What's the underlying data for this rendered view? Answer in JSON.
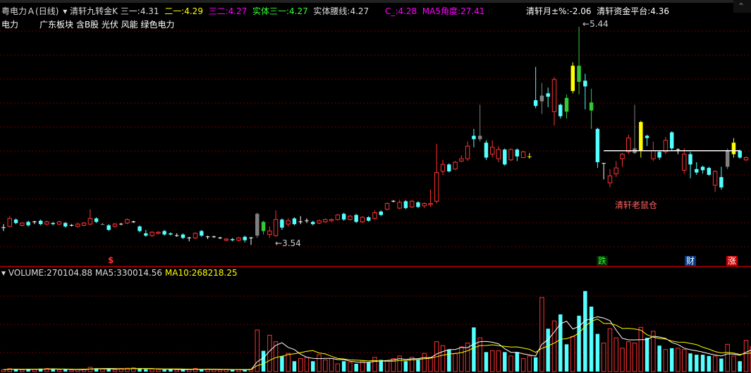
{
  "header": {
    "stock_name": "粤电力Ａ",
    "period": "(日线)",
    "indicator_name": "清轩九转金K",
    "san_yi_label": "三一:",
    "san_yi_value": "4.31",
    "er_yi_label": "二一:",
    "er_yi_value": "4.29",
    "san_er_label": "三二:",
    "san_er_value": "4.27",
    "shiti_label": "实体三一:",
    "shiti_value": "4.27",
    "yaoxian_label": "实体腰线:",
    "yaoxian_value": "4.27",
    "c_label": "C_:",
    "c_value": "4.28",
    "ma5_angle_label": "MA5角度:",
    "ma5_angle_value": "27.41",
    "month_label": "清轩月±%:",
    "month_value": "-2.06",
    "fund_label": "清轩资金平台:",
    "fund_value": "4.36"
  },
  "sector": {
    "industry": "电力",
    "tags": "广东板块 含B股 光伏 风能 绿色电力"
  },
  "annotations": {
    "high_value": "5.44",
    "low_value": "3.54",
    "trap_text": "清轩老鼠仓",
    "marker_dollar": "$",
    "marker_die": "跌",
    "marker_cai": "财",
    "marker_zhang": "涨"
  },
  "volume_header": {
    "volume_label": "VOLUME:",
    "volume_value": "270104.88",
    "ma5_label": "MA5:",
    "ma5_value": "330014.56",
    "ma10_label": "MA10:",
    "ma10_value": "268218.25"
  },
  "colors": {
    "up": "#ff3232",
    "down": "#54ffff",
    "yellow": "#ffff00",
    "gray": "#808080",
    "green": "#34c934",
    "magenta": "#ff00ff"
  },
  "chart_data": {
    "type": "candlestick",
    "price_ylim": [
      3.4,
      5.55
    ],
    "platform_level": 4.36,
    "candles": [
      {
        "o": 3.69,
        "c": 3.69,
        "h": 3.72,
        "l": 3.66,
        "k": "dash"
      },
      {
        "o": 3.7,
        "c": 3.77,
        "h": 3.79,
        "l": 3.69,
        "k": "up"
      },
      {
        "o": 3.76,
        "c": 3.73,
        "h": 3.77,
        "l": 3.72,
        "k": "dn"
      },
      {
        "o": 3.71,
        "c": 3.73,
        "h": 3.74,
        "l": 3.7,
        "k": "up"
      },
      {
        "o": 3.74,
        "c": 3.71,
        "h": 3.75,
        "l": 3.7,
        "k": "dn"
      },
      {
        "o": 3.74,
        "c": 3.74,
        "h": 3.75,
        "l": 3.72,
        "k": "dash"
      },
      {
        "o": 3.75,
        "c": 3.72,
        "h": 3.76,
        "l": 3.71,
        "k": "dn"
      },
      {
        "o": 3.72,
        "c": 3.74,
        "h": 3.75,
        "l": 3.71,
        "k": "up"
      },
      {
        "o": 3.73,
        "c": 3.72,
        "h": 3.74,
        "l": 3.71,
        "k": "dn"
      },
      {
        "o": 3.72,
        "c": 3.74,
        "h": 3.75,
        "l": 3.71,
        "k": "up"
      },
      {
        "o": 3.73,
        "c": 3.7,
        "h": 3.74,
        "l": 3.69,
        "k": "dn"
      },
      {
        "o": 3.71,
        "c": 3.71,
        "h": 3.72,
        "l": 3.7,
        "k": "dash"
      },
      {
        "o": 3.7,
        "c": 3.72,
        "h": 3.73,
        "l": 3.69,
        "k": "up"
      },
      {
        "o": 3.71,
        "c": 3.73,
        "h": 3.74,
        "l": 3.7,
        "k": "up"
      },
      {
        "o": 3.72,
        "c": 3.77,
        "h": 3.85,
        "l": 3.71,
        "k": "up"
      },
      {
        "o": 3.77,
        "c": 3.74,
        "h": 3.78,
        "l": 3.73,
        "k": "dn"
      },
      {
        "o": 3.72,
        "c": 3.72,
        "h": 3.73,
        "l": 3.71,
        "k": "gray"
      },
      {
        "o": 3.71,
        "c": 3.67,
        "h": 3.72,
        "l": 3.66,
        "k": "dn"
      },
      {
        "o": 3.7,
        "c": 3.72,
        "h": 3.73,
        "l": 3.69,
        "k": "up"
      },
      {
        "o": 3.72,
        "c": 3.72,
        "h": 3.73,
        "l": 3.71,
        "k": "dash"
      },
      {
        "o": 3.73,
        "c": 3.76,
        "h": 3.77,
        "l": 3.72,
        "k": "up"
      },
      {
        "o": 3.74,
        "c": 3.74,
        "h": 3.75,
        "l": 3.73,
        "k": "dash"
      },
      {
        "o": 3.7,
        "c": 3.66,
        "h": 3.71,
        "l": 3.65,
        "k": "dn"
      },
      {
        "o": 3.64,
        "c": 3.62,
        "h": 3.67,
        "l": 3.61,
        "k": "dn"
      },
      {
        "o": 3.62,
        "c": 3.65,
        "h": 3.66,
        "l": 3.61,
        "k": "up"
      },
      {
        "o": 3.64,
        "c": 3.65,
        "h": 3.66,
        "l": 3.63,
        "k": "up"
      },
      {
        "o": 3.66,
        "c": 3.63,
        "h": 3.67,
        "l": 3.62,
        "k": "dn"
      },
      {
        "o": 3.64,
        "c": 3.63,
        "h": 3.65,
        "l": 3.62,
        "k": "dn"
      },
      {
        "o": 3.62,
        "c": 3.62,
        "h": 3.64,
        "l": 3.61,
        "k": "dash"
      },
      {
        "o": 3.63,
        "c": 3.6,
        "h": 3.64,
        "l": 3.59,
        "k": "dn"
      },
      {
        "o": 3.6,
        "c": 3.6,
        "h": 3.61,
        "l": 3.57,
        "k": "dash"
      },
      {
        "o": 3.6,
        "c": 3.64,
        "h": 3.65,
        "l": 3.59,
        "k": "up"
      },
      {
        "o": 3.66,
        "c": 3.62,
        "h": 3.67,
        "l": 3.61,
        "k": "dn"
      },
      {
        "o": 3.61,
        "c": 3.61,
        "h": 3.62,
        "l": 3.59,
        "k": "dash"
      },
      {
        "o": 3.61,
        "c": 3.61,
        "h": 3.62,
        "l": 3.6,
        "k": "dash"
      },
      {
        "o": 3.6,
        "c": 3.6,
        "h": 3.61,
        "l": 3.59,
        "k": "dash"
      },
      {
        "o": 3.58,
        "c": 3.59,
        "h": 3.6,
        "l": 3.57,
        "k": "up"
      },
      {
        "o": 3.59,
        "c": 3.58,
        "h": 3.6,
        "l": 3.57,
        "k": "dn"
      },
      {
        "o": 3.58,
        "c": 3.6,
        "h": 3.61,
        "l": 3.57,
        "k": "up"
      },
      {
        "o": 3.61,
        "c": 3.58,
        "h": 3.62,
        "l": 3.56,
        "k": "dn"
      },
      {
        "o": 3.6,
        "c": 3.6,
        "h": 3.61,
        "l": 3.54,
        "k": "dash"
      },
      {
        "o": 3.62,
        "c": 3.81,
        "h": 3.82,
        "l": 3.6,
        "k": "gray"
      },
      {
        "o": 3.74,
        "c": 3.66,
        "h": 3.75,
        "l": 3.63,
        "k": "green"
      },
      {
        "o": 3.63,
        "c": 3.66,
        "h": 3.7,
        "l": 3.6,
        "k": "up"
      },
      {
        "o": 3.62,
        "c": 3.76,
        "h": 3.84,
        "l": 3.61,
        "k": "up"
      },
      {
        "o": 3.76,
        "c": 3.69,
        "h": 3.77,
        "l": 3.67,
        "k": "dn"
      },
      {
        "o": 3.72,
        "c": 3.75,
        "h": 3.77,
        "l": 3.7,
        "k": "up"
      },
      {
        "o": 3.77,
        "c": 3.72,
        "h": 3.78,
        "l": 3.71,
        "k": "dn"
      },
      {
        "o": 3.74,
        "c": 3.74,
        "h": 3.79,
        "l": 3.72,
        "k": "dash"
      },
      {
        "o": 3.75,
        "c": 3.75,
        "h": 3.77,
        "l": 3.73,
        "k": "dash"
      },
      {
        "o": 3.74,
        "c": 3.72,
        "h": 3.75,
        "l": 3.71,
        "k": "dn"
      },
      {
        "o": 3.73,
        "c": 3.75,
        "h": 3.76,
        "l": 3.72,
        "k": "up"
      },
      {
        "o": 3.74,
        "c": 3.76,
        "h": 3.77,
        "l": 3.73,
        "k": "up"
      },
      {
        "o": 3.75,
        "c": 3.76,
        "h": 3.77,
        "l": 3.74,
        "k": "up"
      },
      {
        "o": 3.76,
        "c": 3.8,
        "h": 3.81,
        "l": 3.75,
        "k": "up"
      },
      {
        "o": 3.81,
        "c": 3.76,
        "h": 3.82,
        "l": 3.75,
        "k": "dn"
      },
      {
        "o": 3.76,
        "c": 3.79,
        "h": 3.8,
        "l": 3.75,
        "k": "up"
      },
      {
        "o": 3.8,
        "c": 3.74,
        "h": 3.81,
        "l": 3.73,
        "k": "dn"
      },
      {
        "o": 3.74,
        "c": 3.78,
        "h": 3.79,
        "l": 3.73,
        "k": "up"
      },
      {
        "o": 3.78,
        "c": 3.75,
        "h": 3.79,
        "l": 3.74,
        "k": "dn"
      },
      {
        "o": 3.77,
        "c": 3.82,
        "h": 3.84,
        "l": 3.76,
        "k": "up"
      },
      {
        "o": 3.83,
        "c": 3.8,
        "h": 3.84,
        "l": 3.79,
        "k": "dn"
      },
      {
        "o": 3.85,
        "c": 3.9,
        "h": 3.91,
        "l": 3.84,
        "k": "up"
      },
      {
        "o": 3.92,
        "c": 3.92,
        "h": 3.93,
        "l": 3.91,
        "k": "dash"
      },
      {
        "o": 3.86,
        "c": 3.91,
        "h": 3.93,
        "l": 3.85,
        "k": "up"
      },
      {
        "o": 3.92,
        "c": 3.86,
        "h": 3.93,
        "l": 3.85,
        "k": "dn"
      },
      {
        "o": 3.87,
        "c": 3.92,
        "h": 3.93,
        "l": 3.86,
        "k": "up"
      },
      {
        "o": 3.91,
        "c": 3.87,
        "h": 3.92,
        "l": 3.86,
        "k": "dn"
      },
      {
        "o": 3.88,
        "c": 3.9,
        "h": 3.91,
        "l": 3.86,
        "k": "up"
      },
      {
        "o": 3.89,
        "c": 3.9,
        "h": 4.02,
        "l": 3.87,
        "k": "up"
      },
      {
        "o": 3.92,
        "c": 4.17,
        "h": 4.42,
        "l": 3.9,
        "k": "up"
      },
      {
        "o": 4.18,
        "c": 4.24,
        "h": 4.28,
        "l": 4.15,
        "k": "up"
      },
      {
        "o": 4.24,
        "c": 4.18,
        "h": 4.25,
        "l": 4.17,
        "k": "dn"
      },
      {
        "o": 4.2,
        "c": 4.26,
        "h": 4.27,
        "l": 4.19,
        "k": "up"
      },
      {
        "o": 4.27,
        "c": 4.29,
        "h": 4.32,
        "l": 4.26,
        "k": "up"
      },
      {
        "o": 4.29,
        "c": 4.4,
        "h": 4.44,
        "l": 4.27,
        "k": "up"
      },
      {
        "o": 4.46,
        "c": 4.49,
        "h": 4.55,
        "l": 4.39,
        "k": "dn"
      },
      {
        "o": 4.46,
        "c": 4.49,
        "h": 4.76,
        "l": 4.44,
        "k": "gray"
      },
      {
        "o": 4.43,
        "c": 4.3,
        "h": 4.45,
        "l": 4.28,
        "k": "dn"
      },
      {
        "o": 4.33,
        "c": 4.39,
        "h": 4.45,
        "l": 4.3,
        "k": "up"
      },
      {
        "o": 4.37,
        "c": 4.29,
        "h": 4.4,
        "l": 4.26,
        "k": "up"
      },
      {
        "o": 4.37,
        "c": 4.24,
        "h": 4.38,
        "l": 4.23,
        "k": "dn"
      },
      {
        "o": 4.28,
        "c": 4.37,
        "h": 4.38,
        "l": 4.27,
        "k": "up"
      },
      {
        "o": 4.31,
        "c": 4.37,
        "h": 4.38,
        "l": 4.27,
        "k": "dn"
      },
      {
        "o": 4.3,
        "c": 4.35,
        "h": 4.36,
        "l": 4.3,
        "k": "up"
      },
      {
        "o": 4.31,
        "c": 4.31,
        "h": 4.34,
        "l": 4.29,
        "k": "yellow"
      },
      {
        "o": 4.8,
        "c": 4.75,
        "h": 5.09,
        "l": 4.73,
        "k": "dn"
      },
      {
        "o": 4.79,
        "c": 4.84,
        "h": 4.95,
        "l": 4.68,
        "k": "gray"
      },
      {
        "o": 4.83,
        "c": 4.86,
        "h": 4.91,
        "l": 4.74,
        "k": "dn"
      },
      {
        "o": 4.7,
        "c": 4.98,
        "h": 5.0,
        "l": 4.58,
        "k": "up"
      },
      {
        "o": 4.76,
        "c": 4.66,
        "h": 4.77,
        "l": 4.64,
        "k": "dn"
      },
      {
        "o": 4.7,
        "c": 4.82,
        "h": 4.85,
        "l": 4.64,
        "k": "green"
      },
      {
        "o": 4.88,
        "c": 5.1,
        "h": 5.13,
        "l": 4.86,
        "k": "yellow"
      },
      {
        "o": 4.96,
        "c": 5.1,
        "h": 5.44,
        "l": 4.85,
        "k": "green"
      },
      {
        "o": 4.97,
        "c": 4.92,
        "h": 5.03,
        "l": 4.72,
        "k": "dn"
      },
      {
        "o": 4.78,
        "c": 4.71,
        "h": 4.9,
        "l": 4.55,
        "k": "green"
      },
      {
        "o": 4.55,
        "c": 4.26,
        "h": 4.56,
        "l": 4.21,
        "k": "dn"
      },
      {
        "o": 4.25,
        "c": 4.14,
        "h": 4.25,
        "l": 4.11,
        "k": "dash"
      },
      {
        "o": 4.14,
        "c": 4.08,
        "h": 4.2,
        "l": 4.04,
        "k": "up"
      },
      {
        "o": 4.16,
        "c": 4.21,
        "h": 4.27,
        "l": 4.13,
        "k": "up"
      },
      {
        "o": 4.29,
        "c": 4.33,
        "h": 4.34,
        "l": 4.22,
        "k": "up"
      },
      {
        "o": 4.35,
        "c": 4.47,
        "h": 4.5,
        "l": 4.33,
        "k": "up"
      },
      {
        "o": 4.38,
        "c": 4.34,
        "h": 4.76,
        "l": 4.33,
        "k": "gray"
      },
      {
        "o": 4.61,
        "c": 4.36,
        "h": 4.62,
        "l": 4.3,
        "k": "yellow"
      },
      {
        "o": 4.49,
        "c": 4.47,
        "h": 4.5,
        "l": 4.4,
        "k": "dn"
      },
      {
        "o": 4.36,
        "c": 4.29,
        "h": 4.44,
        "l": 4.27,
        "k": "up"
      },
      {
        "o": 4.3,
        "c": 4.35,
        "h": 4.36,
        "l": 4.28,
        "k": "dn"
      },
      {
        "o": 4.35,
        "c": 4.45,
        "h": 4.48,
        "l": 4.33,
        "k": "up"
      },
      {
        "o": 4.38,
        "c": 4.52,
        "h": 4.53,
        "l": 4.36,
        "k": "dn"
      },
      {
        "o": 4.35,
        "c": 4.37,
        "h": 4.38,
        "l": 4.33,
        "k": "dash"
      },
      {
        "o": 4.33,
        "c": 4.19,
        "h": 4.38,
        "l": 4.16,
        "k": "up"
      },
      {
        "o": 4.33,
        "c": 4.24,
        "h": 4.35,
        "l": 4.12,
        "k": "dn"
      },
      {
        "o": 4.2,
        "c": 4.17,
        "h": 4.26,
        "l": 4.15,
        "k": "dn"
      },
      {
        "o": 4.22,
        "c": 4.19,
        "h": 4.23,
        "l": 4.16,
        "k": "dn"
      },
      {
        "o": 4.21,
        "c": 4.15,
        "h": 4.22,
        "l": 4.14,
        "k": "dn"
      },
      {
        "o": 4.18,
        "c": 4.06,
        "h": 4.19,
        "l": 4.0,
        "k": "up"
      },
      {
        "o": 4.13,
        "c": 4.04,
        "h": 4.22,
        "l": 4.02,
        "k": "dn"
      },
      {
        "o": 4.22,
        "c": 4.36,
        "h": 4.38,
        "l": 4.2,
        "k": "gray"
      },
      {
        "o": 4.33,
        "c": 4.43,
        "h": 4.47,
        "l": 4.3,
        "k": "yellow"
      },
      {
        "o": 4.36,
        "c": 4.3,
        "h": 4.37,
        "l": 4.29,
        "k": "dn"
      },
      {
        "o": 4.3,
        "c": 4.28,
        "h": 4.31,
        "l": 4.27,
        "k": "up"
      }
    ],
    "volume_ylim": [
      0,
      700000
    ],
    "volume": [
      15000,
      22000,
      18000,
      14000,
      21000,
      17000,
      23000,
      24000,
      20000,
      14000,
      16000,
      13000,
      17000,
      19000,
      33000,
      26000,
      20000,
      22000,
      15000,
      24000,
      26000,
      29000,
      22000,
      18000,
      20000,
      17000,
      15000,
      21000,
      14000,
      13000,
      19000,
      24000,
      14000,
      20000,
      16000,
      14000,
      16000,
      14000,
      15000,
      12000,
      18000,
      320000,
      160000,
      280000,
      230000,
      120000,
      140000,
      80000,
      100000,
      110000,
      80000,
      130000,
      90000,
      100000,
      60000,
      80000,
      70000,
      60000,
      80000,
      70000,
      110000,
      90000,
      80000,
      100000,
      120000,
      80000,
      110000,
      90000,
      140000,
      110000,
      230000,
      200000,
      170000,
      140000,
      190000,
      220000,
      340000,
      260000,
      150000,
      160000,
      160000,
      150000,
      120000,
      150000,
      100000,
      120000,
      110000,
      570000,
      330000,
      390000,
      440000,
      210000,
      270000,
      430000,
      620000,
      500000,
      290000,
      220000,
      330000,
      260000,
      180000,
      230000,
      220000,
      340000,
      260000,
      310000,
      200000,
      170000,
      180000,
      180000,
      170000,
      140000,
      130000,
      130000,
      120000,
      120000,
      100000,
      210000,
      120000,
      80000,
      240000,
      190000,
      150000
    ]
  }
}
